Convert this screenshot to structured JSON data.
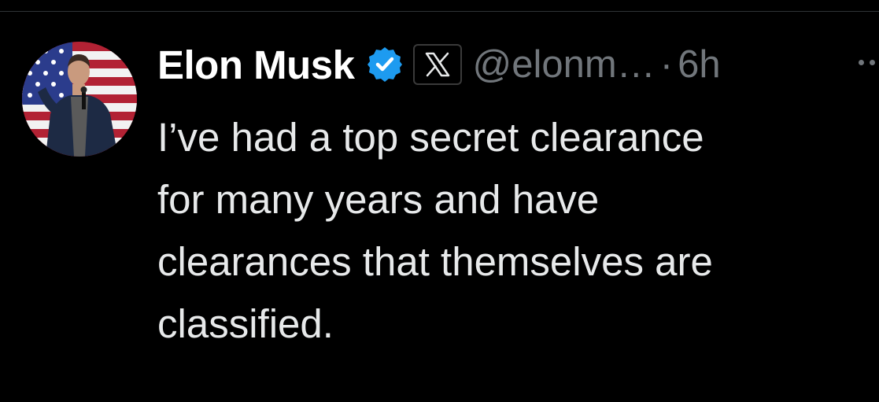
{
  "tweet": {
    "author": {
      "display_name": "Elon Musk",
      "handle": "@elonm…",
      "verified": true,
      "avatar_description": "man speaking with microphone in front of American flag",
      "affiliate_icon": "x-logo-icon"
    },
    "separator": "·",
    "time_ago": "6h",
    "text_lines": [
      "I’ve had a top secret clearance",
      "for many years and have",
      "clearances that themselves are",
      "classified."
    ]
  },
  "colors": {
    "background": "#000000",
    "text": "#e7e9ea",
    "secondary": "#71767b",
    "verified_blue": "#1d9bf0"
  }
}
